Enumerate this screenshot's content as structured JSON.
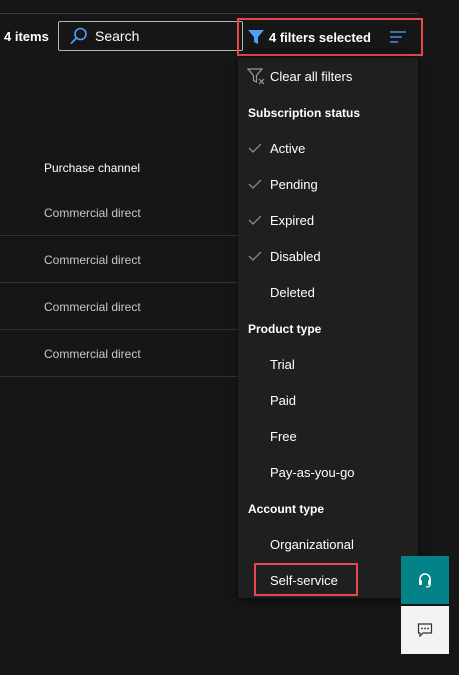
{
  "toolbar": {
    "items_count": "4 items",
    "search_placeholder": "Search",
    "filter_label": "4 filters selected",
    "filter_icon": "filter-icon",
    "sort_icon": "sort-lines-icon"
  },
  "table": {
    "column_header": "Purchase channel",
    "rows": [
      "Commercial direct",
      "Commercial direct",
      "Commercial direct",
      "Commercial direct"
    ]
  },
  "filter_menu": {
    "clear_label": "Clear all filters",
    "sections": [
      {
        "header": "Subscription status",
        "items": [
          {
            "label": "Active",
            "checked": true
          },
          {
            "label": "Pending",
            "checked": true
          },
          {
            "label": "Expired",
            "checked": true
          },
          {
            "label": "Disabled",
            "checked": true
          },
          {
            "label": "Deleted",
            "checked": false
          }
        ]
      },
      {
        "header": "Product type",
        "items": [
          {
            "label": "Trial",
            "checked": false
          },
          {
            "label": "Paid",
            "checked": false
          },
          {
            "label": "Free",
            "checked": false
          },
          {
            "label": "Pay-as-you-go",
            "checked": false
          }
        ]
      },
      {
        "header": "Account type",
        "items": [
          {
            "label": "Organizational",
            "checked": false
          },
          {
            "label": "Self-service",
            "checked": false
          }
        ]
      }
    ]
  },
  "floating": {
    "help_icon": "headset-icon",
    "feedback_icon": "feedback-icon"
  },
  "colors": {
    "background": "#161616",
    "menu_background": "#1f1f1f",
    "accent_blue": "#4ea0ff",
    "highlight_red": "#e8474b",
    "teal": "#038387"
  }
}
